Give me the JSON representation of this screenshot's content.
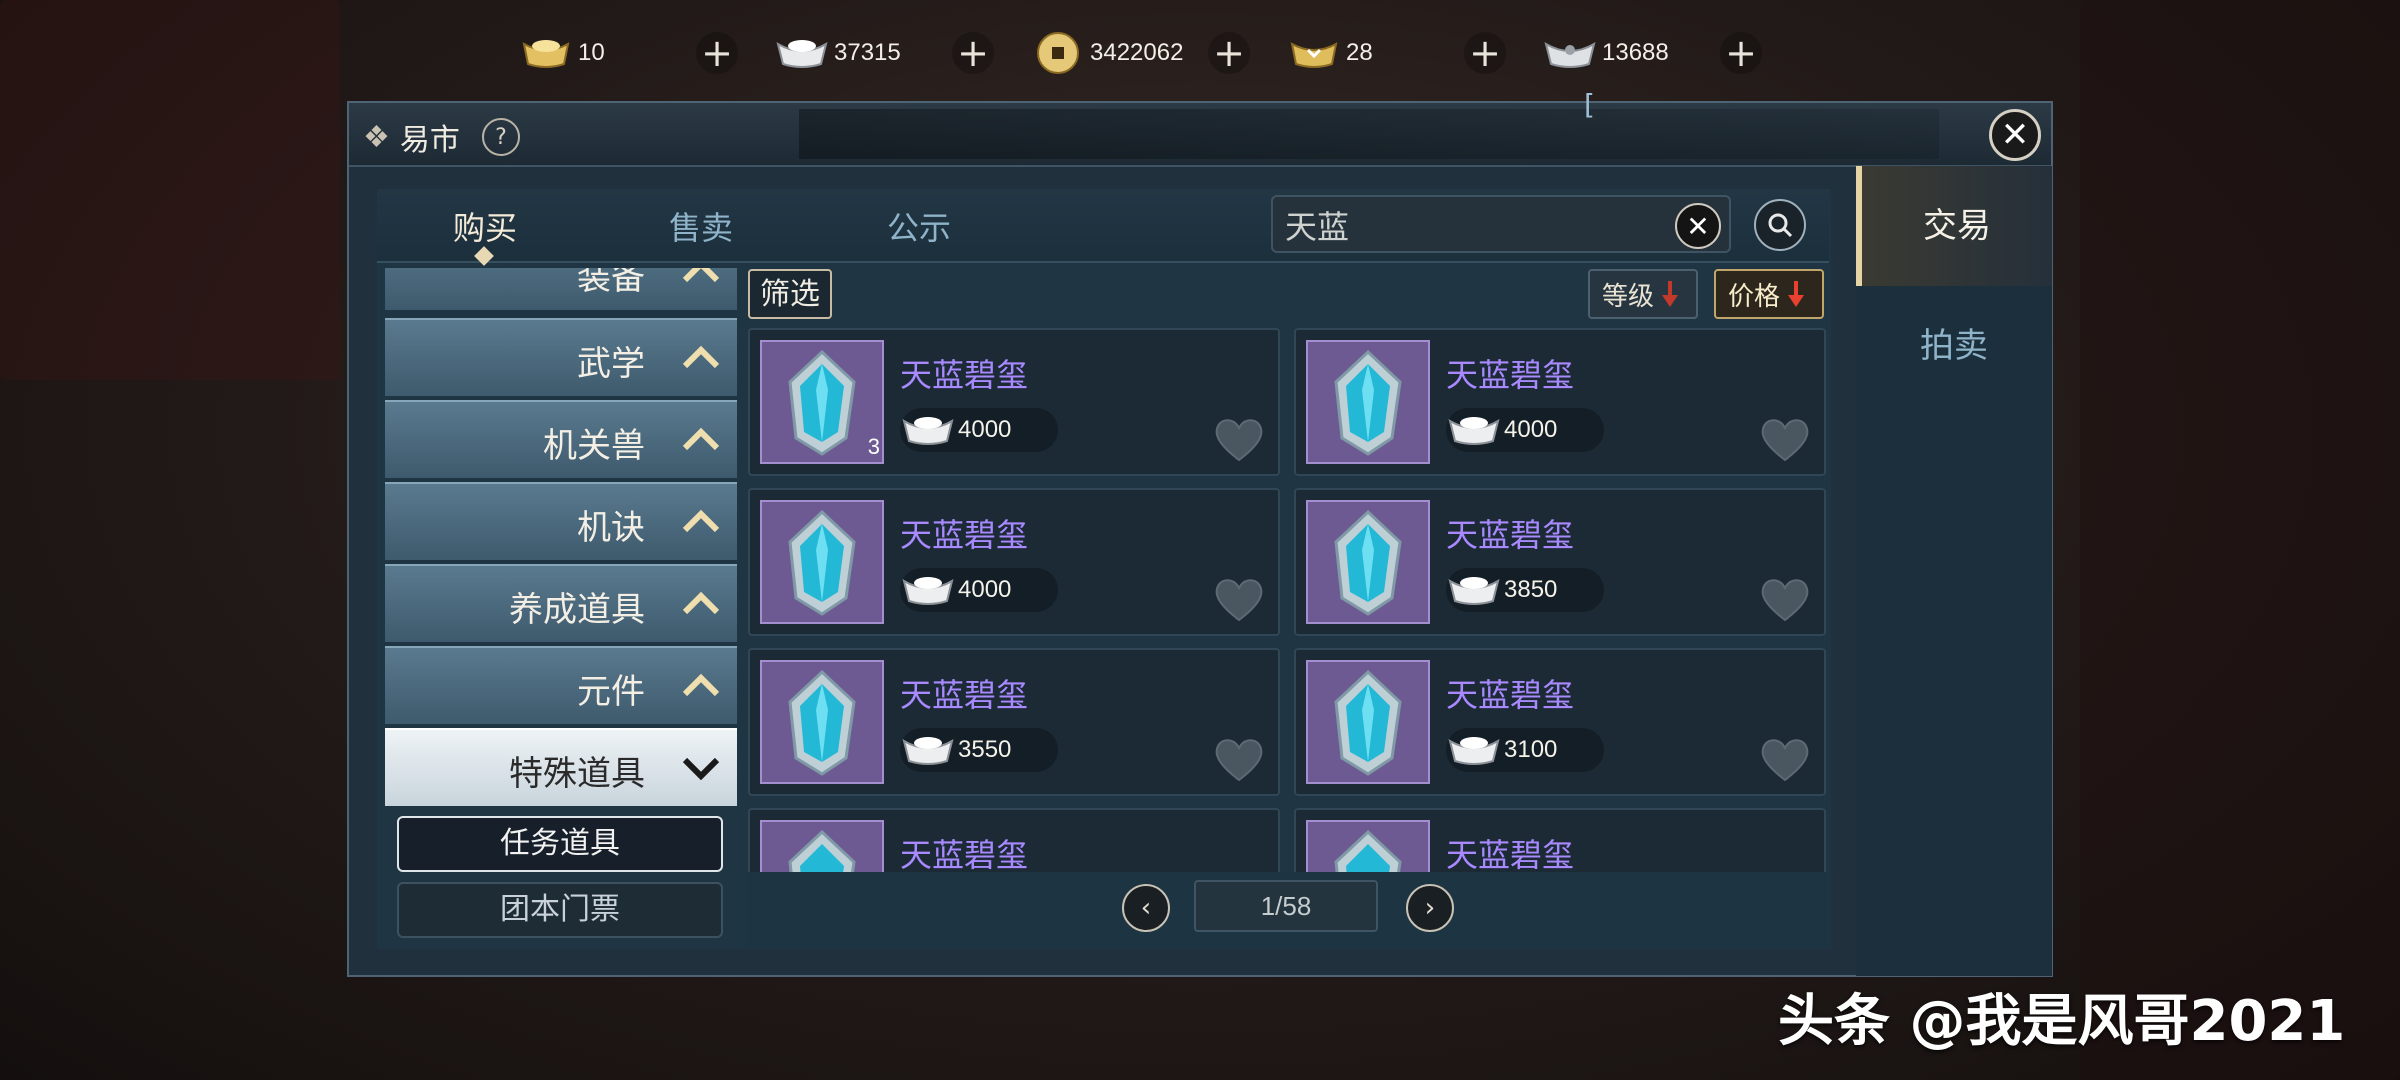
{
  "currency": [
    {
      "icon": "gold-ingot-icon",
      "value": "10"
    },
    {
      "icon": "silver-ingot-icon",
      "value": "37315"
    },
    {
      "icon": "copper-coin-icon",
      "value": "3422062"
    },
    {
      "icon": "gold-token-icon",
      "value": "28"
    },
    {
      "icon": "silver-token-icon",
      "value": "13688"
    }
  ],
  "window": {
    "title": "易市",
    "help": "?"
  },
  "tabs": [
    "购买",
    "售卖",
    "公示"
  ],
  "search": {
    "value": "天蓝"
  },
  "categories": [
    {
      "label": "装备"
    },
    {
      "label": "武学"
    },
    {
      "label": "机关兽"
    },
    {
      "label": "机诀"
    },
    {
      "label": "养成道具"
    },
    {
      "label": "元件"
    },
    {
      "label": "特殊道具"
    }
  ],
  "subcategories": [
    "任务道具",
    "团本门票"
  ],
  "filter_label": "筛选",
  "sort": {
    "level": "等级",
    "price": "价格"
  },
  "items": [
    {
      "name": "天蓝碧玺",
      "price": "4000",
      "qty": "3"
    },
    {
      "name": "天蓝碧玺",
      "price": "4000",
      "qty": ""
    },
    {
      "name": "天蓝碧玺",
      "price": "4000",
      "qty": ""
    },
    {
      "name": "天蓝碧玺",
      "price": "3850",
      "qty": ""
    },
    {
      "name": "天蓝碧玺",
      "price": "3550",
      "qty": ""
    },
    {
      "name": "天蓝碧玺",
      "price": "3100",
      "qty": ""
    },
    {
      "name": "天蓝碧玺",
      "price": "",
      "qty": ""
    },
    {
      "name": "天蓝碧玺",
      "price": "",
      "qty": ""
    }
  ],
  "pager": {
    "label": "1/58",
    "prev": "‹",
    "next": "›"
  },
  "side_tabs": [
    "交易",
    "拍卖"
  ],
  "watermark": "头条 @我是风哥2021",
  "colors": {
    "item_name": "#a889ff",
    "slot_bg": "#6d5a93",
    "panel": "#1f3543",
    "accent": "#e4d4a6"
  }
}
